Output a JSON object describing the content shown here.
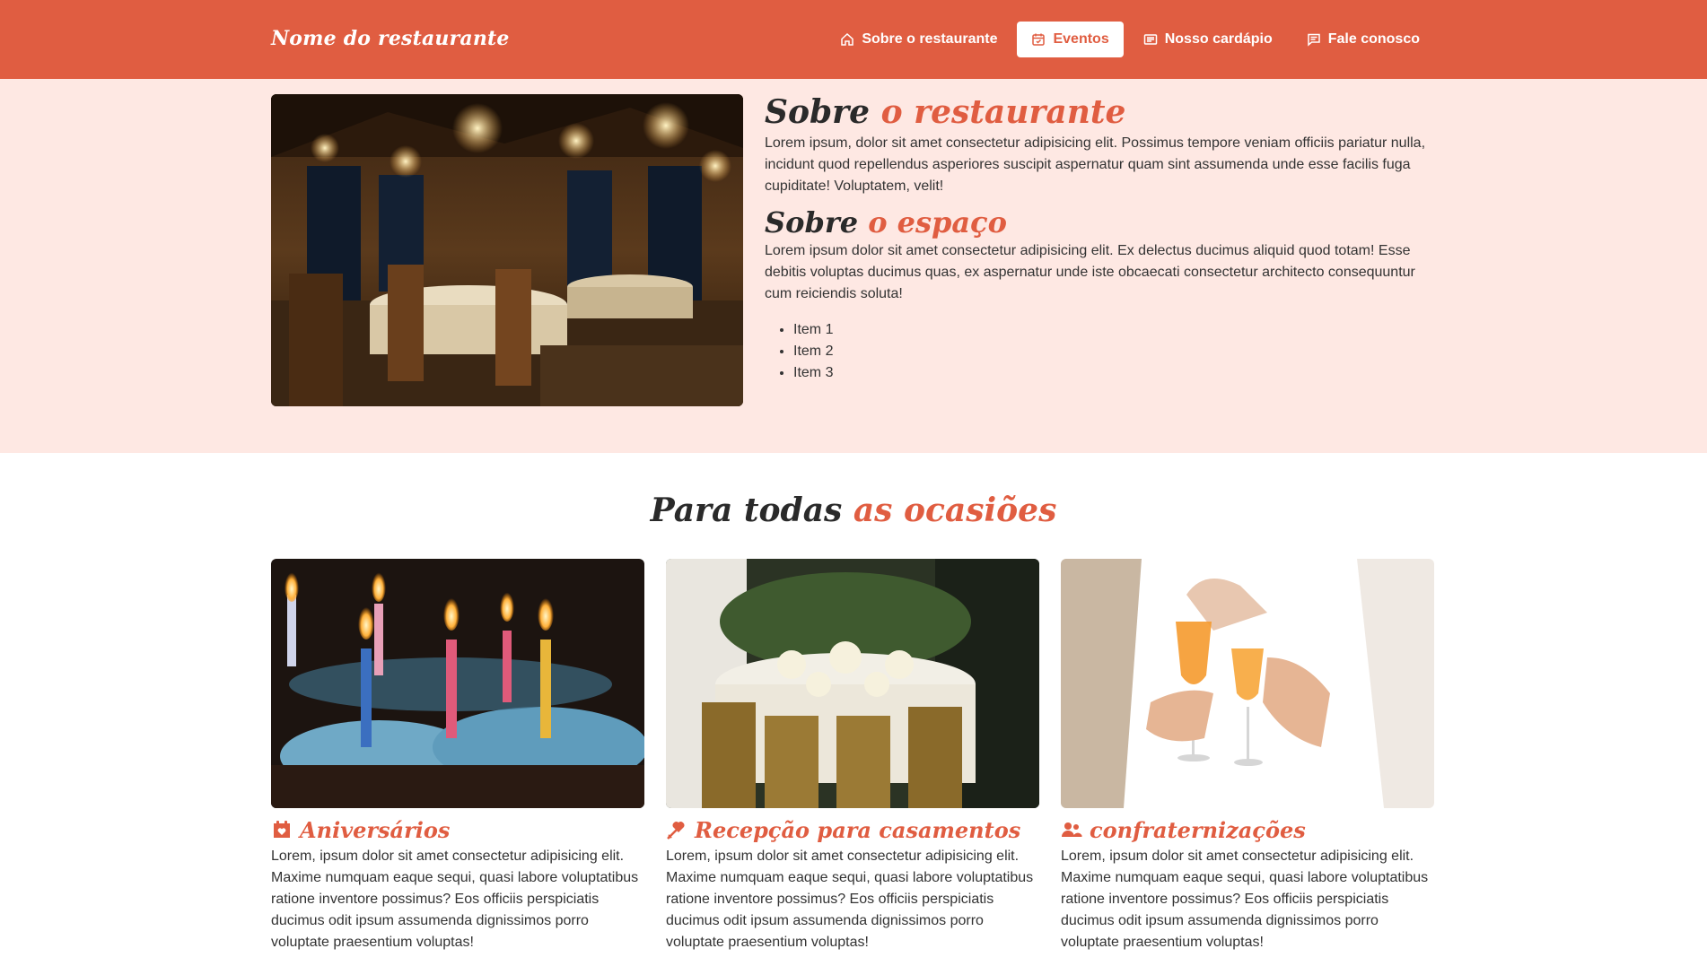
{
  "navbar": {
    "brand": "Nome do restaurante",
    "items": [
      {
        "label": "Sobre o restaurante",
        "icon": "home-icon",
        "active": false
      },
      {
        "label": "Eventos",
        "icon": "calendar-icon",
        "active": true
      },
      {
        "label": "Nosso cardápio",
        "icon": "menu-list-icon",
        "active": false
      },
      {
        "label": "Fale conosco",
        "icon": "chat-icon",
        "active": false
      }
    ]
  },
  "about": {
    "title_part1": "Sobre",
    "title_part2": "o restaurante",
    "text1": "Lorem ipsum, dolor sit amet consectetur adipisicing elit. Possimus tempore veniam officiis pariatur nulla, incidunt quod repellendus asperiores suscipit aspernatur quam sint assumenda unde esse facilis fuga cupiditate! Voluptatem, velit!",
    "subtitle_part1": "Sobre",
    "subtitle_part2": "o espaço",
    "text2": "Lorem ipsum dolor sit amet consectetur adipisicing elit. Ex delectus ducimus aliquid quod totam! Esse debitis voluptas ducimus quas, ex aspernatur unde iste obcaecati consectetur architecto consequuntur cum reiciendis soluta!",
    "items": [
      "Item 1",
      "Item 2",
      "Item 3"
    ]
  },
  "occasions": {
    "title_part1": "Para todas",
    "title_part2": "as ocasiões",
    "cards": [
      {
        "title": "Aniversários",
        "icon": "calendar-heart-icon",
        "text": "Lorem, ipsum dolor sit amet consectetur adipisicing elit. Maxime numquam eaque sequi, quasi labore voluptatibus ratione inventore possimus? Eos officiis perspiciatis ducimus odit ipsum assumenda dignissimos porro voluptate praesentium voluptas!"
      },
      {
        "title": "Recepção para casamentos",
        "icon": "cupid-arrow-icon",
        "text": "Lorem, ipsum dolor sit amet consectetur adipisicing elit. Maxime numquam eaque sequi, quasi labore voluptatibus ratione inventore possimus? Eos officiis perspiciatis ducimus odit ipsum assumenda dignissimos porro voluptate praesentium voluptas!"
      },
      {
        "title": "confraternizações",
        "icon": "users-icon",
        "text": "Lorem, ipsum dolor sit amet consectetur adipisicing elit. Maxime numquam eaque sequi, quasi labore voluptatibus ratione inventore possimus? Eos officiis perspiciatis ducimus odit ipsum assumenda dignissimos porro voluptate praesentium voluptas!"
      }
    ]
  },
  "colors": {
    "primary": "#e05d41",
    "section_bg": "#fee8e3",
    "heading": "#2a2a2a",
    "text": "#333333"
  }
}
